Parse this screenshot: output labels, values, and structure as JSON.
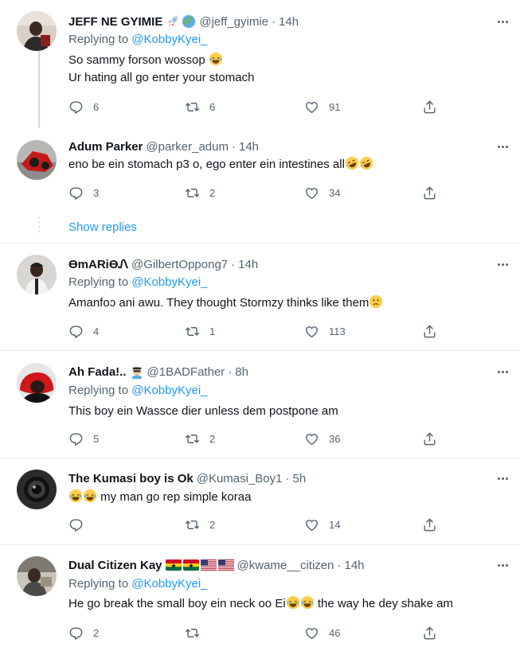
{
  "tweets": [
    {
      "name": "JEFF NE GYIMIE",
      "name_badges": [
        "rocket-emoji",
        "globe-emoji"
      ],
      "handle": "@jeff_gyimie",
      "time": "14h",
      "replying_prefix": "Replying to ",
      "replying_to": "@KobbyKyei_",
      "lines": [
        "So sammy forson wossop",
        "Ur hating all go enter your stomach"
      ],
      "replies": "6",
      "retweets": "6",
      "likes": "91"
    },
    {
      "name": "Adum Parker",
      "handle": "@parker_adum",
      "time": "14h",
      "lines": [
        "eno be ein stomach p3 o, ego enter ein intestines all"
      ],
      "replies": "3",
      "retweets": "2",
      "likes": "34",
      "show_replies": "Show replies"
    },
    {
      "name": "ӨmARiӨᏁ",
      "handle": "@GilbertOppong7",
      "time": "14h",
      "replying_prefix": "Replying to ",
      "replying_to": "@KobbyKyei_",
      "lines": [
        "Amanfoɔ ani awu. They thought Stormzy thinks like them"
      ],
      "replies": "4",
      "retweets": "1",
      "likes": "113"
    },
    {
      "name": "Ah Fada!..",
      "name_badges": [
        "man-emoji"
      ],
      "handle": "@1BADFather",
      "time": "8h",
      "replying_prefix": "Replying to ",
      "replying_to": "@KobbyKyei_",
      "lines": [
        "This boy ein Wassce dier unless dem postpone am"
      ],
      "replies": "5",
      "retweets": "2",
      "likes": "36"
    },
    {
      "name": "The Kumasi boy is Ok",
      "handle": "@Kumasi_Boy1",
      "time": "5h",
      "lines": [
        "my man go rep simple koraa"
      ],
      "replies": "",
      "retweets": "2",
      "likes": "14"
    },
    {
      "name": "Dual Citizen Kay",
      "name_badges": [
        "flag-ghana",
        "flag-ghana",
        "flag-usa",
        "flag-usa"
      ],
      "handle": "@kwame__citizen",
      "time": "14h",
      "replying_prefix": "Replying to ",
      "replying_to": "@KobbyKyei_",
      "lines_a": "He go break the small boy ein neck oo Ei",
      "lines_b": "the way he dey shake am",
      "replies": "2",
      "retweets": "",
      "likes": "46"
    }
  ],
  "separator": "·",
  "colors": {
    "text": "#0f1419",
    "secondary": "#536471",
    "link": "#1d9bf0",
    "divider": "#e6ecf0"
  },
  "icons": [
    "reply-icon",
    "retweet-icon",
    "like-icon",
    "share-icon",
    "more-icon",
    "laughing-emoji",
    "rofl-emoji",
    "frown-emoji"
  ]
}
